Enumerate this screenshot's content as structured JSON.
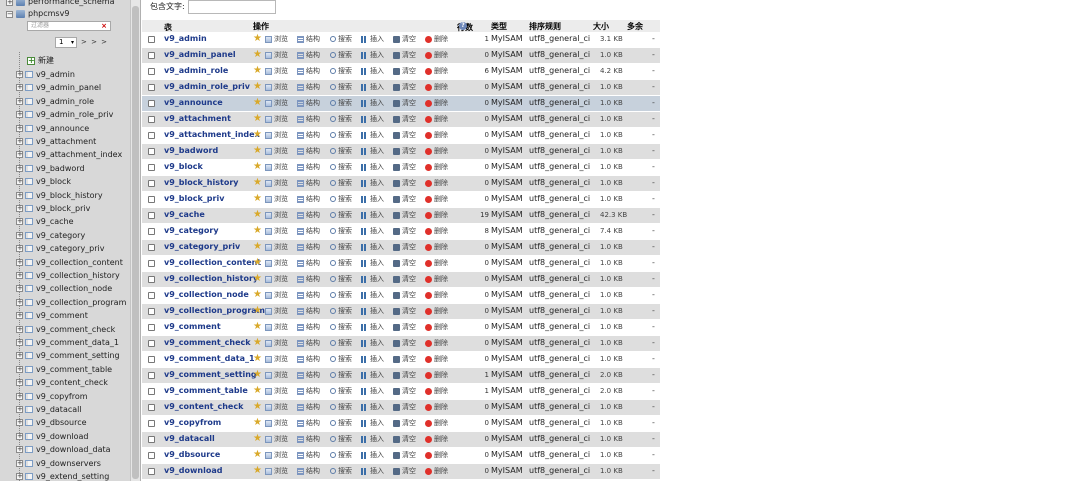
{
  "sidebar": {
    "top_db": "performance_schema",
    "current_db": "phpcmsv9",
    "filter_placeholder": "过滤器",
    "filter_clear": "×",
    "page_value": "1",
    "page_next": "> > >",
    "new_label": "新建",
    "tables": [
      "v9_admin",
      "v9_admin_panel",
      "v9_admin_role",
      "v9_admin_role_priv",
      "v9_announce",
      "v9_attachment",
      "v9_attachment_index",
      "v9_badword",
      "v9_block",
      "v9_block_history",
      "v9_block_priv",
      "v9_cache",
      "v9_category",
      "v9_category_priv",
      "v9_collection_content",
      "v9_collection_history",
      "v9_collection_node",
      "v9_collection_program",
      "v9_comment",
      "v9_comment_check",
      "v9_comment_data_1",
      "v9_comment_setting",
      "v9_comment_table",
      "v9_content_check",
      "v9_copyfrom",
      "v9_datacall",
      "v9_dbsource",
      "v9_download",
      "v9_download_data",
      "v9_downservers",
      "v9_extend_setting"
    ]
  },
  "filter": {
    "label": "包含文字:"
  },
  "table": {
    "headers": {
      "table": "表",
      "sort": "▲",
      "action": "操作",
      "rows": "行数",
      "type": "类型",
      "collation": "排序规则",
      "size": "大小",
      "overhead": "多余"
    },
    "actions": {
      "browse": "浏览",
      "structure": "结构",
      "search": "搜索",
      "insert": "插入",
      "empty": "清空",
      "drop": "删除"
    },
    "rows": [
      {
        "name": "v9_admin",
        "rows": "1",
        "type": "MyISAM",
        "collation": "utf8_general_ci",
        "size": "3.1 KB",
        "overhead": "-"
      },
      {
        "name": "v9_admin_panel",
        "rows": "0",
        "type": "MyISAM",
        "collation": "utf8_general_ci",
        "size": "1.0 KB",
        "overhead": "-"
      },
      {
        "name": "v9_admin_role",
        "rows": "6",
        "type": "MyISAM",
        "collation": "utf8_general_ci",
        "size": "4.2 KB",
        "overhead": "-"
      },
      {
        "name": "v9_admin_role_priv",
        "rows": "0",
        "type": "MyISAM",
        "collation": "utf8_general_ci",
        "size": "1.0 KB",
        "overhead": "-"
      },
      {
        "name": "v9_announce",
        "rows": "0",
        "type": "MyISAM",
        "collation": "utf8_general_ci",
        "size": "1.0 KB",
        "overhead": "-"
      },
      {
        "name": "v9_attachment",
        "rows": "0",
        "type": "MyISAM",
        "collation": "utf8_general_ci",
        "size": "1.0 KB",
        "overhead": "-"
      },
      {
        "name": "v9_attachment_index",
        "rows": "0",
        "type": "MyISAM",
        "collation": "utf8_general_ci",
        "size": "1.0 KB",
        "overhead": "-"
      },
      {
        "name": "v9_badword",
        "rows": "0",
        "type": "MyISAM",
        "collation": "utf8_general_ci",
        "size": "1.0 KB",
        "overhead": "-"
      },
      {
        "name": "v9_block",
        "rows": "0",
        "type": "MyISAM",
        "collation": "utf8_general_ci",
        "size": "1.0 KB",
        "overhead": "-"
      },
      {
        "name": "v9_block_history",
        "rows": "0",
        "type": "MyISAM",
        "collation": "utf8_general_ci",
        "size": "1.0 KB",
        "overhead": "-"
      },
      {
        "name": "v9_block_priv",
        "rows": "0",
        "type": "MyISAM",
        "collation": "utf8_general_ci",
        "size": "1.0 KB",
        "overhead": "-"
      },
      {
        "name": "v9_cache",
        "rows": "19",
        "type": "MyISAM",
        "collation": "utf8_general_ci",
        "size": "42.3 KB",
        "overhead": "-"
      },
      {
        "name": "v9_category",
        "rows": "8",
        "type": "MyISAM",
        "collation": "utf8_general_ci",
        "size": "7.4 KB",
        "overhead": "-"
      },
      {
        "name": "v9_category_priv",
        "rows": "0",
        "type": "MyISAM",
        "collation": "utf8_general_ci",
        "size": "1.0 KB",
        "overhead": "-"
      },
      {
        "name": "v9_collection_content",
        "rows": "0",
        "type": "MyISAM",
        "collation": "utf8_general_ci",
        "size": "1.0 KB",
        "overhead": "-"
      },
      {
        "name": "v9_collection_history",
        "rows": "0",
        "type": "MyISAM",
        "collation": "utf8_general_ci",
        "size": "1.0 KB",
        "overhead": "-"
      },
      {
        "name": "v9_collection_node",
        "rows": "0",
        "type": "MyISAM",
        "collation": "utf8_general_ci",
        "size": "1.0 KB",
        "overhead": "-"
      },
      {
        "name": "v9_collection_program",
        "rows": "0",
        "type": "MyISAM",
        "collation": "utf8_general_ci",
        "size": "1.0 KB",
        "overhead": "-"
      },
      {
        "name": "v9_comment",
        "rows": "0",
        "type": "MyISAM",
        "collation": "utf8_general_ci",
        "size": "1.0 KB",
        "overhead": "-"
      },
      {
        "name": "v9_comment_check",
        "rows": "0",
        "type": "MyISAM",
        "collation": "utf8_general_ci",
        "size": "1.0 KB",
        "overhead": "-"
      },
      {
        "name": "v9_comment_data_1",
        "rows": "0",
        "type": "MyISAM",
        "collation": "utf8_general_ci",
        "size": "1.0 KB",
        "overhead": "-"
      },
      {
        "name": "v9_comment_setting",
        "rows": "1",
        "type": "MyISAM",
        "collation": "utf8_general_ci",
        "size": "2.0 KB",
        "overhead": "-"
      },
      {
        "name": "v9_comment_table",
        "rows": "1",
        "type": "MyISAM",
        "collation": "utf8_general_ci",
        "size": "2.0 KB",
        "overhead": "-"
      },
      {
        "name": "v9_content_check",
        "rows": "0",
        "type": "MyISAM",
        "collation": "utf8_general_ci",
        "size": "1.0 KB",
        "overhead": "-"
      },
      {
        "name": "v9_copyfrom",
        "rows": "0",
        "type": "MyISAM",
        "collation": "utf8_general_ci",
        "size": "1.0 KB",
        "overhead": "-"
      },
      {
        "name": "v9_datacall",
        "rows": "0",
        "type": "MyISAM",
        "collation": "utf8_general_ci",
        "size": "1.0 KB",
        "overhead": "-"
      },
      {
        "name": "v9_dbsource",
        "rows": "0",
        "type": "MyISAM",
        "collation": "utf8_general_ci",
        "size": "1.0 KB",
        "overhead": "-"
      },
      {
        "name": "v9_download",
        "rows": "0",
        "type": "MyISAM",
        "collation": "utf8_general_ci",
        "size": "1.0 KB",
        "overhead": "-"
      }
    ]
  }
}
